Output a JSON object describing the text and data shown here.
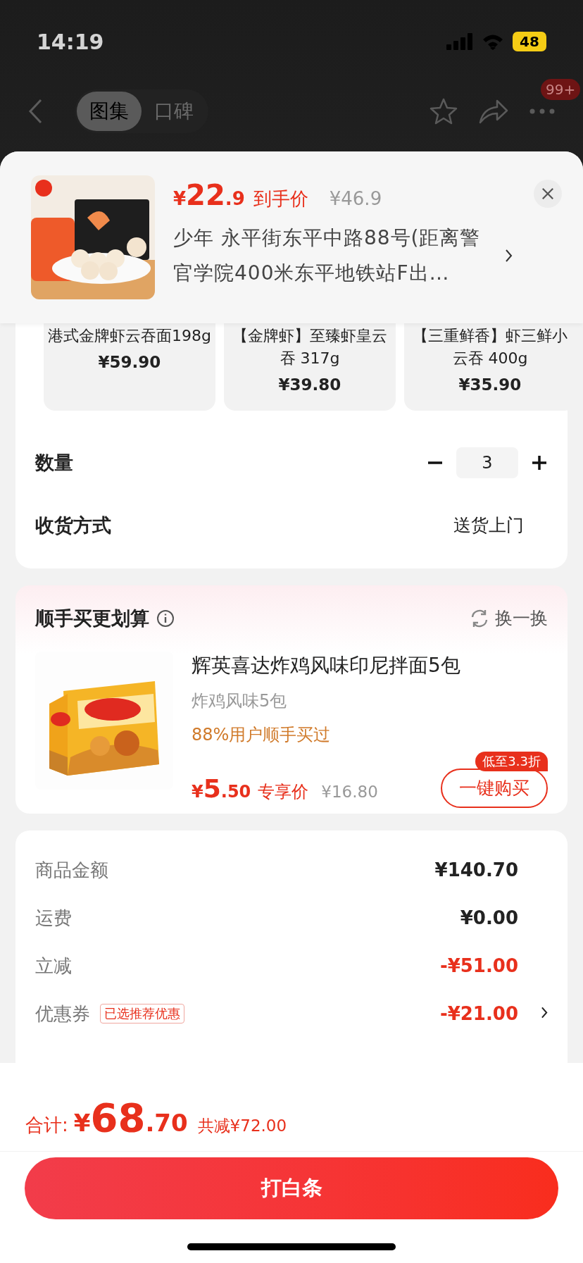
{
  "status_bar": {
    "time": "14:19",
    "battery": "48"
  },
  "nav": {
    "tabs": [
      {
        "label": "图集",
        "selected": true
      },
      {
        "label": "口碑",
        "selected": false
      }
    ],
    "badge": "99+"
  },
  "product_header": {
    "price": {
      "symbol": "¥",
      "main": "22",
      "fraction": ".9"
    },
    "price_label": "到手价",
    "original_price": "¥46.9",
    "address": "少年  永平街东平中路88号(距离警官学院400米东平地铁站F出…"
  },
  "variants": [
    {
      "title": "港式金牌虾云吞面198g",
      "price": "¥59.90"
    },
    {
      "title": "【金牌虾】至臻虾皇云吞 317g",
      "price": "¥39.80"
    },
    {
      "title": "【三重鲜香】虾三鲜小云吞 400g",
      "price": "¥35.90"
    }
  ],
  "quantity": {
    "label": "数量",
    "value": "3"
  },
  "delivery": {
    "label": "收货方式",
    "value": "送货上门"
  },
  "addon": {
    "title": "顺手买更划算",
    "refresh": "换一换",
    "name": "辉英喜达炸鸡风味印尼拌面5包",
    "spec": "炸鸡风味5包",
    "social": "88%用户顺手买过",
    "price": {
      "symbol": "¥",
      "main": "5",
      "fraction": ".50"
    },
    "price_label": "专享价",
    "original_price": "¥16.80",
    "badge": "低至3.3折",
    "button": "一键购买"
  },
  "summary": [
    {
      "label": "商品金额",
      "value": "¥140.70",
      "deduction": false,
      "link": false
    },
    {
      "label": "运费",
      "value": "¥0.00",
      "deduction": false,
      "link": false
    },
    {
      "label": "立减",
      "value": "-¥51.00",
      "deduction": true,
      "link": false
    },
    {
      "label": "优惠券",
      "tag": "已选推荐优惠",
      "value": "-¥21.00",
      "deduction": true,
      "link": true
    }
  ],
  "footer": {
    "total_label": "合计:",
    "total": {
      "symbol": "¥",
      "main": "68",
      "fraction": ".70"
    },
    "saved": "共减¥72.00",
    "button": "打白条"
  }
}
